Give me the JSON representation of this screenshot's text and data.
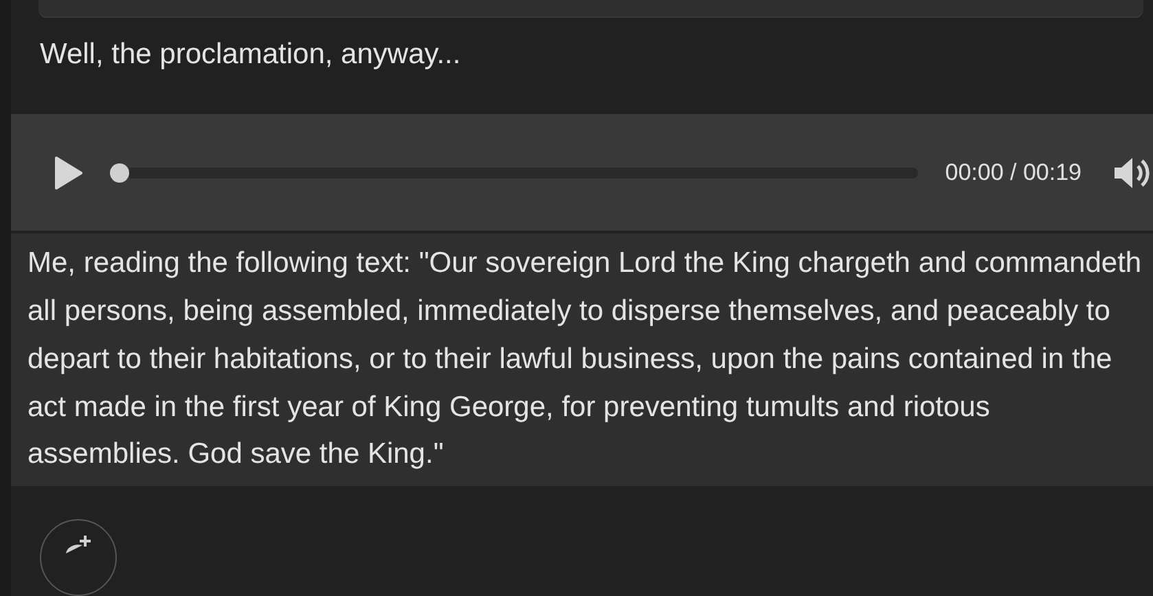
{
  "message": {
    "text": "Well, the proclamation, anyway..."
  },
  "audio": {
    "level": 0,
    "time": "00:00 / 00:19"
  },
  "caption": {
    "text": "Me, reading the following text: \"Our sovereign Lord the King chargeth and commandeth all persons, being assembled, immediately to disperse themselves, and peaceably to depart to their habitations, or to their lawful business, upon the pains contained in the act made in the first year of King George, for preventing tumults and riotous assemblies. God save the King.\""
  }
}
